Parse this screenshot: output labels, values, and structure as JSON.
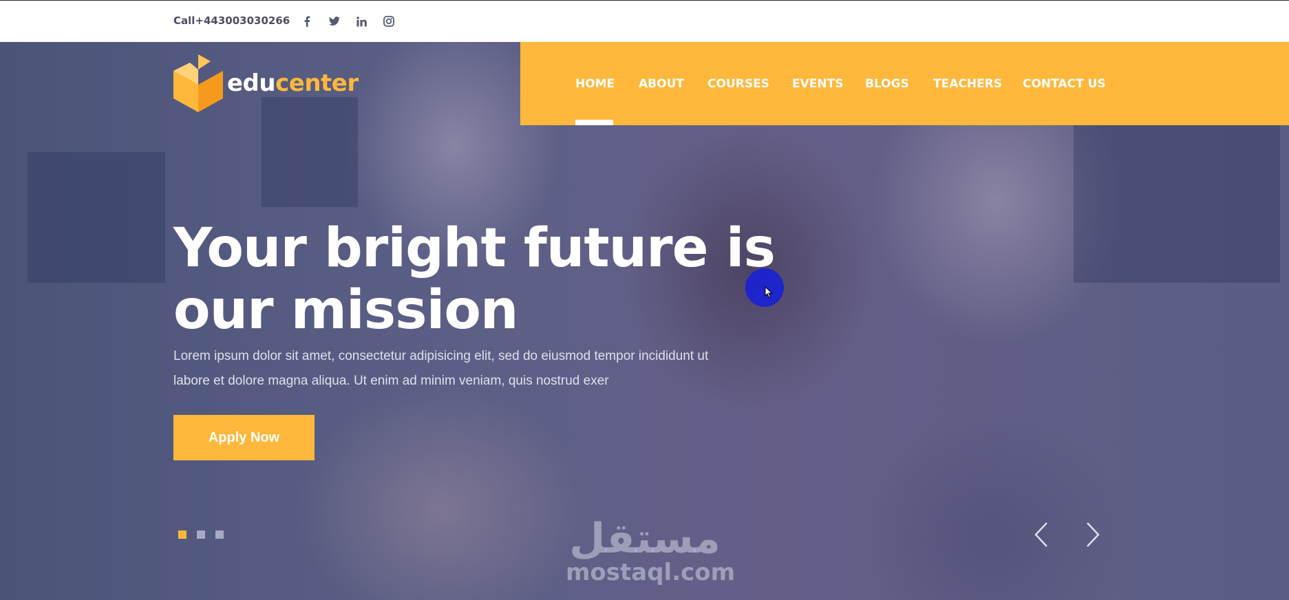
{
  "topbar": {
    "phone": "Call+443003030266",
    "social": [
      {
        "icon": "facebook-icon"
      },
      {
        "icon": "twitter-icon"
      },
      {
        "icon": "linkedin-icon"
      },
      {
        "icon": "instagram-icon"
      }
    ]
  },
  "brand": {
    "part1": "edu",
    "part2": "center",
    "accent": "#ffb83b"
  },
  "nav": {
    "items": [
      "HOME",
      "ABOUT",
      "COURSES",
      "EVENTS",
      "BLOGS",
      "TEACHERS",
      "CONTACT US"
    ],
    "active": "HOME",
    "background": "#ffb83b"
  },
  "hero": {
    "title_line1": "Your bright future is",
    "title_line2": "our mission",
    "description_line1": "Lorem ipsum dolor sit amet, consectetur adipisicing elit, sed do eiusmod tempor incididunt ut",
    "description_line2": "labore et dolore magna aliqua. Ut enim ad minim veniam, quis nostrud exer",
    "cta_label": "Apply Now"
  },
  "slider": {
    "slide_count": 3,
    "active_slide": 1
  },
  "watermark": {
    "arabic": "مستقل",
    "latin": "mostaql.com"
  }
}
